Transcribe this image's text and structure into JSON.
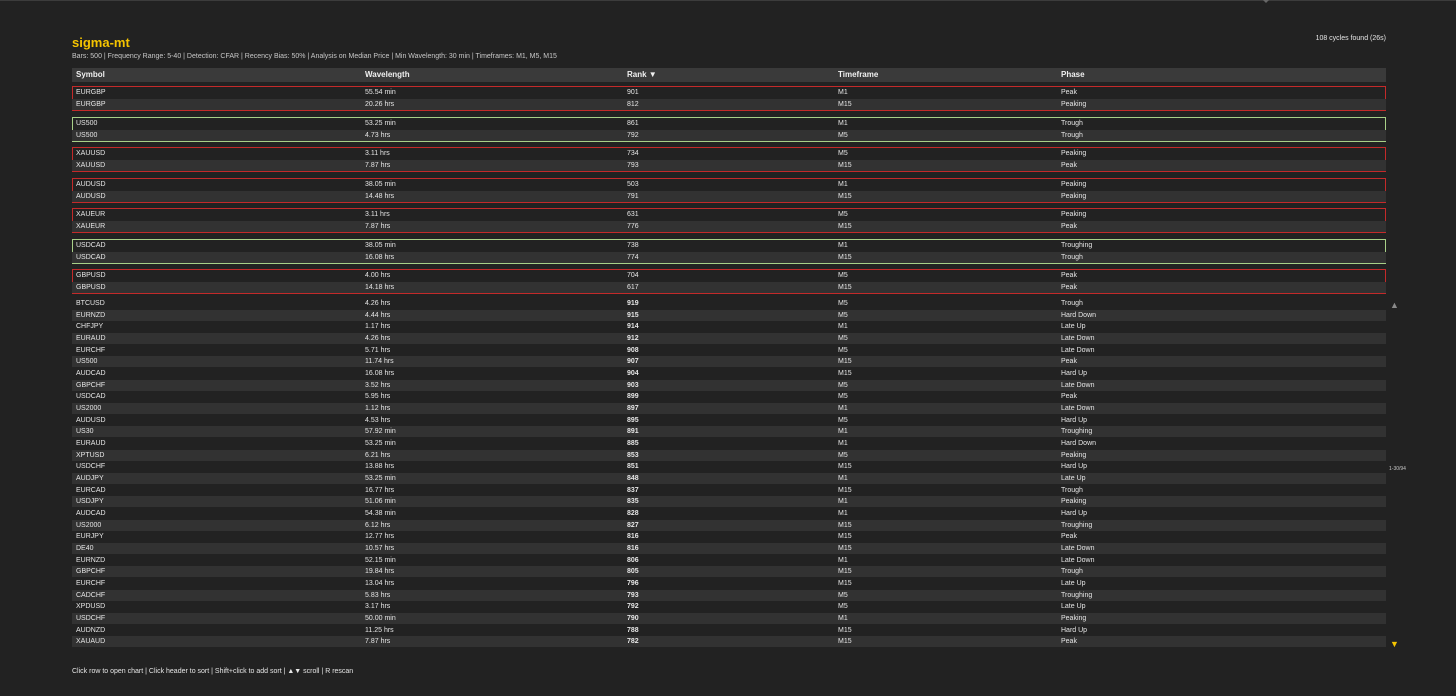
{
  "app": {
    "title": "sigma-mt",
    "params": "Bars: 500  |  Frequency Range: 5-40  |  Detection: CFAR  |  Recency Bias: 50%  |  Analysis on Median Price  |  Min Wavelength: 30 min  |  Timeframes: M1, M5, M15",
    "found": "108 cycles found (26s)",
    "accent_color": "#f5c400"
  },
  "table": {
    "headers": {
      "symbol": "Symbol",
      "wavelength": "Wavelength",
      "rank": "Rank ▼",
      "timeframe": "Timeframe",
      "phase": "Phase"
    },
    "groups": [
      {
        "color": "red",
        "rows": [
          {
            "symbol": "EURGBP",
            "wavelength": "55.54 min",
            "rank": "901",
            "timeframe": "M1",
            "phase": "Peak"
          },
          {
            "symbol": "EURGBP",
            "wavelength": "20.26 hrs",
            "rank": "812",
            "timeframe": "M15",
            "phase": "Peaking"
          }
        ]
      },
      {
        "color": "green",
        "rows": [
          {
            "symbol": "US500",
            "wavelength": "53.25 min",
            "rank": "861",
            "timeframe": "M1",
            "phase": "Trough"
          },
          {
            "symbol": "US500",
            "wavelength": "4.73 hrs",
            "rank": "792",
            "timeframe": "M5",
            "phase": "Trough"
          }
        ]
      },
      {
        "color": "red",
        "rows": [
          {
            "symbol": "XAUUSD",
            "wavelength": "3.11 hrs",
            "rank": "734",
            "timeframe": "M5",
            "phase": "Peaking"
          },
          {
            "symbol": "XAUUSD",
            "wavelength": "7.87 hrs",
            "rank": "793",
            "timeframe": "M15",
            "phase": "Peak"
          }
        ]
      },
      {
        "color": "red",
        "rows": [
          {
            "symbol": "AUDUSD",
            "wavelength": "38.05 min",
            "rank": "503",
            "timeframe": "M1",
            "phase": "Peaking"
          },
          {
            "symbol": "AUDUSD",
            "wavelength": "14.48 hrs",
            "rank": "791",
            "timeframe": "M15",
            "phase": "Peaking"
          }
        ]
      },
      {
        "color": "red",
        "rows": [
          {
            "symbol": "XAUEUR",
            "wavelength": "3.11 hrs",
            "rank": "631",
            "timeframe": "M5",
            "phase": "Peaking"
          },
          {
            "symbol": "XAUEUR",
            "wavelength": "7.87 hrs",
            "rank": "776",
            "timeframe": "M15",
            "phase": "Peak"
          }
        ]
      },
      {
        "color": "green",
        "rows": [
          {
            "symbol": "USDCAD",
            "wavelength": "38.05 min",
            "rank": "738",
            "timeframe": "M1",
            "phase": "Troughing"
          },
          {
            "symbol": "USDCAD",
            "wavelength": "16.08 hrs",
            "rank": "774",
            "timeframe": "M15",
            "phase": "Trough"
          }
        ]
      },
      {
        "color": "red",
        "rows": [
          {
            "symbol": "GBPUSD",
            "wavelength": "4.00 hrs",
            "rank": "704",
            "timeframe": "M5",
            "phase": "Peak"
          },
          {
            "symbol": "GBPUSD",
            "wavelength": "14.18 hrs",
            "rank": "617",
            "timeframe": "M15",
            "phase": "Peak"
          }
        ]
      }
    ],
    "rows": [
      {
        "symbol": "BTCUSD",
        "wavelength": "4.26 hrs",
        "rank": "919",
        "timeframe": "M5",
        "phase": "Trough"
      },
      {
        "symbol": "EURNZD",
        "wavelength": "4.44 hrs",
        "rank": "915",
        "timeframe": "M5",
        "phase": "Hard Down"
      },
      {
        "symbol": "CHFJPY",
        "wavelength": "1.17 hrs",
        "rank": "914",
        "timeframe": "M1",
        "phase": "Late Up"
      },
      {
        "symbol": "EURAUD",
        "wavelength": "4.26 hrs",
        "rank": "912",
        "timeframe": "M5",
        "phase": "Late Down"
      },
      {
        "symbol": "EURCHF",
        "wavelength": "5.71 hrs",
        "rank": "908",
        "timeframe": "M5",
        "phase": "Late Down"
      },
      {
        "symbol": "US500",
        "wavelength": "11.74 hrs",
        "rank": "907",
        "timeframe": "M15",
        "phase": "Peak"
      },
      {
        "symbol": "AUDCAD",
        "wavelength": "16.08 hrs",
        "rank": "904",
        "timeframe": "M15",
        "phase": "Hard Up"
      },
      {
        "symbol": "GBPCHF",
        "wavelength": "3.52 hrs",
        "rank": "903",
        "timeframe": "M5",
        "phase": "Late Down"
      },
      {
        "symbol": "USDCAD",
        "wavelength": "5.95 hrs",
        "rank": "899",
        "timeframe": "M5",
        "phase": "Peak"
      },
      {
        "symbol": "US2000",
        "wavelength": "1.12 hrs",
        "rank": "897",
        "timeframe": "M1",
        "phase": "Late Down"
      },
      {
        "symbol": "AUDUSD",
        "wavelength": "4.53 hrs",
        "rank": "895",
        "timeframe": "M5",
        "phase": "Hard Up"
      },
      {
        "symbol": "US30",
        "wavelength": "57.92 min",
        "rank": "891",
        "timeframe": "M1",
        "phase": "Troughing"
      },
      {
        "symbol": "EURAUD",
        "wavelength": "53.25 min",
        "rank": "885",
        "timeframe": "M1",
        "phase": "Hard Down"
      },
      {
        "symbol": "XPTUSD",
        "wavelength": "6.21 hrs",
        "rank": "853",
        "timeframe": "M5",
        "phase": "Peaking"
      },
      {
        "symbol": "USDCHF",
        "wavelength": "13.88 hrs",
        "rank": "851",
        "timeframe": "M15",
        "phase": "Hard Up"
      },
      {
        "symbol": "AUDJPY",
        "wavelength": "53.25 min",
        "rank": "848",
        "timeframe": "M1",
        "phase": "Late Up"
      },
      {
        "symbol": "EURCAD",
        "wavelength": "16.77 hrs",
        "rank": "837",
        "timeframe": "M15",
        "phase": "Trough"
      },
      {
        "symbol": "USDJPY",
        "wavelength": "51.06 min",
        "rank": "835",
        "timeframe": "M1",
        "phase": "Peaking"
      },
      {
        "symbol": "AUDCAD",
        "wavelength": "54.38 min",
        "rank": "828",
        "timeframe": "M1",
        "phase": "Hard Up"
      },
      {
        "symbol": "US2000",
        "wavelength": "6.12 hrs",
        "rank": "827",
        "timeframe": "M15",
        "phase": "Troughing"
      },
      {
        "symbol": "EURJPY",
        "wavelength": "12.77 hrs",
        "rank": "816",
        "timeframe": "M15",
        "phase": "Peak"
      },
      {
        "symbol": "DE40",
        "wavelength": "10.57 hrs",
        "rank": "816",
        "timeframe": "M15",
        "phase": "Late Down"
      },
      {
        "symbol": "EURNZD",
        "wavelength": "52.15 min",
        "rank": "806",
        "timeframe": "M1",
        "phase": "Late Down"
      },
      {
        "symbol": "GBPCHF",
        "wavelength": "19.84 hrs",
        "rank": "805",
        "timeframe": "M15",
        "phase": "Trough"
      },
      {
        "symbol": "EURCHF",
        "wavelength": "13.04 hrs",
        "rank": "796",
        "timeframe": "M15",
        "phase": "Late Up"
      },
      {
        "symbol": "CADCHF",
        "wavelength": "5.83 hrs",
        "rank": "793",
        "timeframe": "M5",
        "phase": "Troughing"
      },
      {
        "symbol": "XPDUSD",
        "wavelength": "3.17 hrs",
        "rank": "792",
        "timeframe": "M5",
        "phase": "Late Up"
      },
      {
        "symbol": "USDCHF",
        "wavelength": "50.00 min",
        "rank": "790",
        "timeframe": "M1",
        "phase": "Peaking"
      },
      {
        "symbol": "AUDNZD",
        "wavelength": "11.25 hrs",
        "rank": "788",
        "timeframe": "M15",
        "phase": "Hard Up"
      },
      {
        "symbol": "XAUAUD",
        "wavelength": "7.87 hrs",
        "rank": "782",
        "timeframe": "M15",
        "phase": "Peak"
      }
    ]
  },
  "scroll": {
    "up_icon": "▲",
    "down_icon": "▼",
    "position": "1-30/94"
  },
  "footer": {
    "help": "Click row to open chart  |  Click header to sort  |  Shift+click to add sort  |  ▲▼ scroll  |  R rescan"
  }
}
